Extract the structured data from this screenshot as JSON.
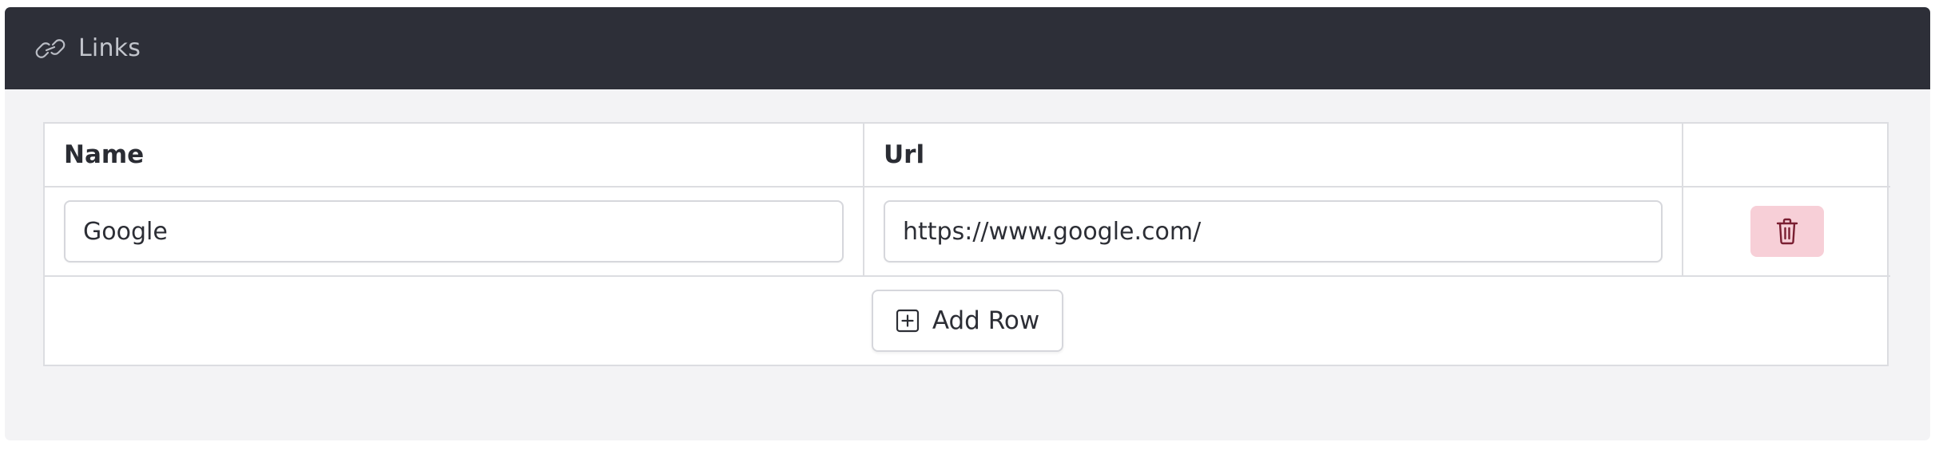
{
  "panel": {
    "title": "Links",
    "icon": "link-icon"
  },
  "table": {
    "columns": [
      "Name",
      "Url",
      ""
    ],
    "rows": [
      {
        "name": "Google",
        "url": "https://www.google.com/",
        "delete_icon": "trash-icon"
      }
    ]
  },
  "add_row": {
    "label": "Add Row",
    "icon": "plus-square-icon"
  },
  "colors": {
    "header_bg": "#2d2f38",
    "panel_bg": "#f3f3f5",
    "delete_bg": "#f7cfd7",
    "delete_icon": "#7a1f32"
  }
}
